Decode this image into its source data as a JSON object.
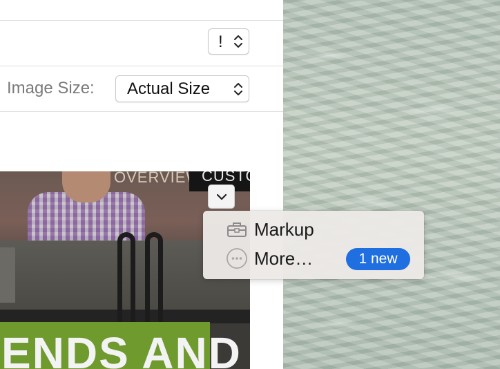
{
  "settings": {
    "top_popup": {
      "value": "!"
    },
    "image_size": {
      "label": "Image Size:",
      "value": "Actual Size"
    }
  },
  "preview": {
    "overview_text": "OVERVIEW",
    "customers_text": "CUSTOM",
    "headline_text": "ENDS AND"
  },
  "menu": {
    "items": [
      {
        "label": "Markup",
        "icon": "toolbox-icon"
      },
      {
        "label": "More…",
        "icon": "more-icon",
        "badge": "1 new"
      }
    ]
  },
  "colors": {
    "badge": "#1f6fe0",
    "accent_green": "#6e9a2e"
  }
}
